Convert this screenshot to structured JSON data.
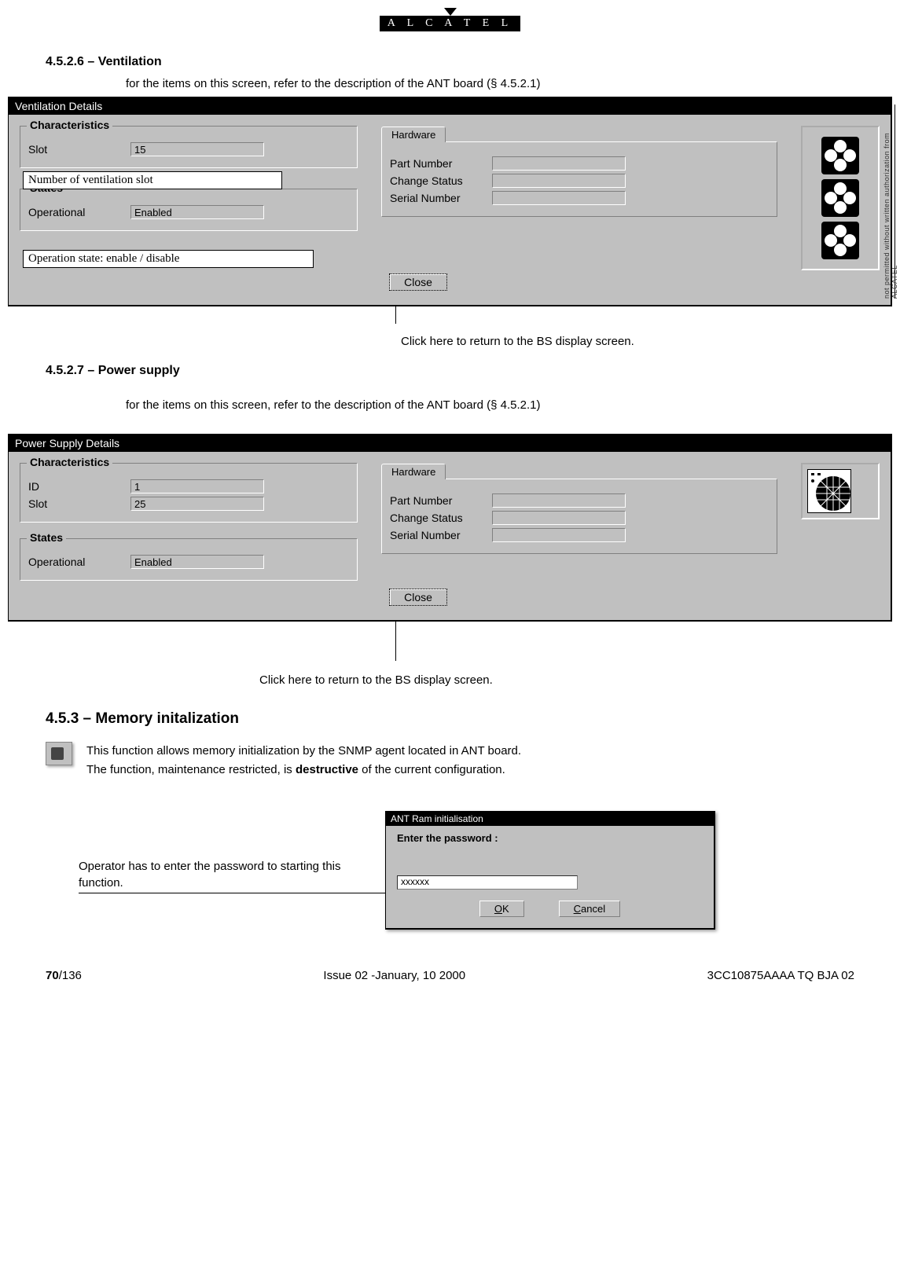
{
  "brand": "A L C A T E L",
  "side_note": "not permitted without written authorization from ALCATEL",
  "sec_4526": {
    "heading": "4.5.2.6 – Ventilation",
    "intro": "for the items on this screen, refer to the description of the ANT board (§ 4.5.2.1)",
    "dlg_title": "Ventilation Details",
    "char_legend": "Characteristics",
    "slot_label": "Slot",
    "slot_value": "15",
    "states_legend": "States",
    "op_label": "Operational",
    "op_value": "Enabled",
    "hw_tab": "Hardware",
    "pn_label": "Part Number",
    "cs_label": "Change Status",
    "sn_label": "Serial Number",
    "close": "Close",
    "callout1": "Number of ventilation slot",
    "callout2": "Operation state: enable / disable",
    "caption": "Click here to return to the BS display screen."
  },
  "sec_4527": {
    "heading": "4.5.2.7 – Power supply",
    "intro": "for the items on this screen, refer to the description of the ANT board (§ 4.5.2.1)",
    "dlg_title": "Power Supply Details",
    "char_legend": "Characteristics",
    "id_label": "ID",
    "id_value": "1",
    "slot_label": "Slot",
    "slot_value": "25",
    "states_legend": "States",
    "op_label": "Operational",
    "op_value": "Enabled",
    "hw_tab": "Hardware",
    "pn_label": "Part Number",
    "cs_label": "Change Status",
    "sn_label": "Serial Number",
    "close": "Close",
    "caption": "Click here to return to the BS display screen."
  },
  "sec_453": {
    "heading": "4.5.3 – Memory initalization",
    "p1": "This function allows memory initialization by the SNMP agent located in ANT board.",
    "p2a": "The function, maintenance restricted, is ",
    "p2b": "destructive",
    "p2c": " of the current configuration.",
    "callout": "Operator has to enter the password to starting this function.",
    "dlg_title": "ANT Ram initialisation",
    "prompt": "Enter the password :",
    "pw_value": "xxxxxx",
    "ok": "OK",
    "cancel": "Cancel"
  },
  "footer": {
    "page_a": "70",
    "page_b": "/136",
    "issue": "Issue 02 -January, 10 2000",
    "doc": "3CC10875AAAA TQ BJA 02"
  }
}
